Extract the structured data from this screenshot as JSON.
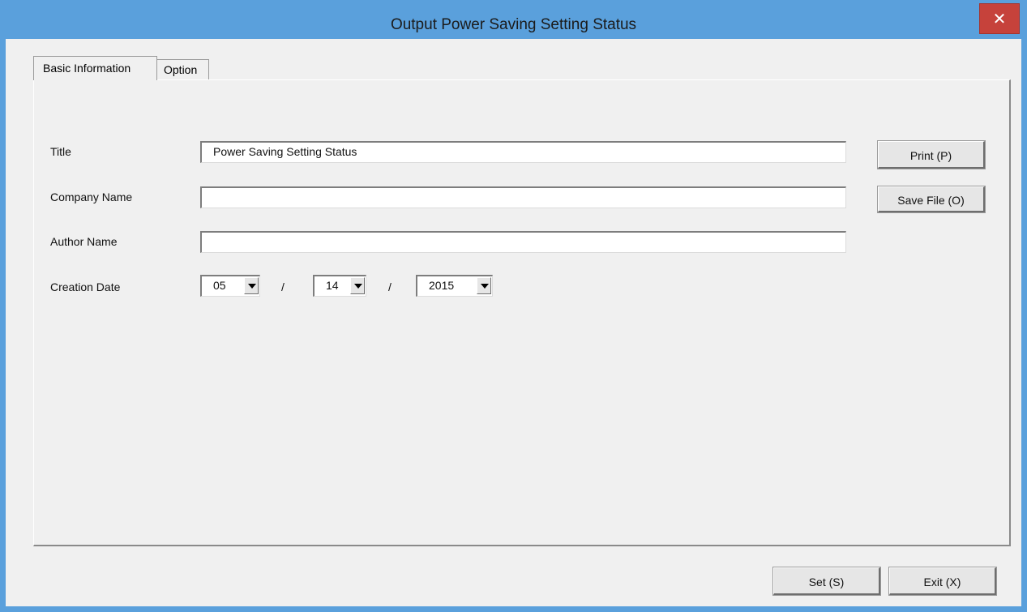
{
  "window": {
    "title": "Output Power Saving Setting Status",
    "close_glyph": "✕"
  },
  "tabs": [
    {
      "label": "Basic Information",
      "selected": true
    },
    {
      "label": "Option",
      "selected": false
    }
  ],
  "form": {
    "title_label": "Title",
    "title_value": "Power Saving Setting Status",
    "company_label": "Company Name",
    "company_value": "",
    "author_label": "Author Name",
    "author_value": "",
    "date_label": "Creation Date",
    "date_month": "05",
    "date_day": "14",
    "date_year": "2015",
    "date_separator": "/"
  },
  "buttons": {
    "print": "Print (P)",
    "save_file": "Save File (O)",
    "set": "Set (S)",
    "exit": "Exit (X)"
  },
  "colors": {
    "titlebar": "#5aa0dc",
    "close": "#c6423b",
    "dialog_bg": "#f0f0f0"
  }
}
